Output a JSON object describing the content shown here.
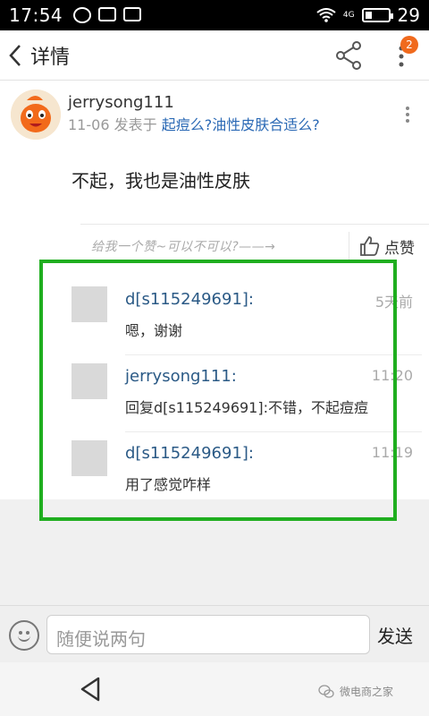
{
  "status_bar": {
    "time": "17:54",
    "network": "4G",
    "battery": "29",
    "battery_fraction": 0.29
  },
  "header": {
    "title": "详情",
    "notification_count": "2"
  },
  "post": {
    "username": "jerrysong111",
    "date": "11-06",
    "posted_in": "发表于",
    "topic": "起痘么?油性皮肤合适么?",
    "content": "不起，我也是油性皮肤",
    "like_hint": "给我一个赞~可以不可以?——→",
    "like_label": "点赞"
  },
  "comments": [
    {
      "name": "d[s115249691]:",
      "time": "5天前",
      "text": "嗯，谢谢"
    },
    {
      "name": "jerrysong111:",
      "time": "11:20",
      "text": "回复d[s115249691]:不错，不起痘痘"
    },
    {
      "name": "d[s115249691]:",
      "time": "11:19",
      "text": "用了感觉咋样"
    }
  ],
  "input_bar": {
    "placeholder": "随便说两句",
    "send_label": "发送"
  },
  "watermark": "微电商之家",
  "colors": {
    "accent_link": "#2b69b5",
    "highlight": "#1fae1f",
    "badge": "#f06a1d"
  }
}
